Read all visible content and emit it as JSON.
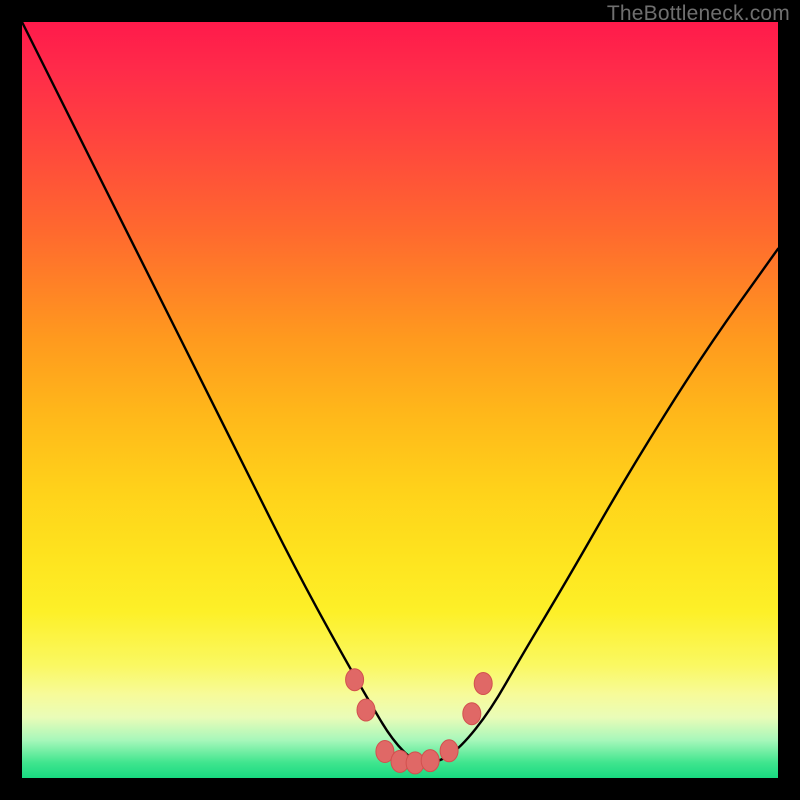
{
  "watermark": "TheBottleneck.com",
  "colors": {
    "page_bg": "#000000",
    "curve_stroke": "#000000",
    "marker_fill": "#e06866",
    "marker_stroke": "#d2504e",
    "watermark": "#6f6f6f"
  },
  "chart_data": {
    "type": "line",
    "title": "",
    "xlabel": "",
    "ylabel": "",
    "xlim": [
      0,
      100
    ],
    "ylim": [
      0,
      100
    ],
    "grid": false,
    "legend": false,
    "background": "vertical-gradient red→orange→yellow→green (top→bottom)",
    "series": [
      {
        "name": "bottleneck-curve",
        "x": [
          0,
          6,
          12,
          18,
          24,
          30,
          36,
          42,
          46,
          49,
          52,
          55,
          58,
          62,
          66,
          72,
          80,
          90,
          100
        ],
        "y": [
          100,
          88,
          76,
          64,
          52,
          40,
          28,
          17,
          10,
          5,
          2,
          2,
          4,
          9,
          16,
          26,
          40,
          56,
          70
        ]
      }
    ],
    "markers": [
      {
        "x": 44.0,
        "y": 13.0
      },
      {
        "x": 45.5,
        "y": 9.0
      },
      {
        "x": 48.0,
        "y": 3.5
      },
      {
        "x": 50.0,
        "y": 2.2
      },
      {
        "x": 52.0,
        "y": 2.0
      },
      {
        "x": 54.0,
        "y": 2.3
      },
      {
        "x": 56.5,
        "y": 3.6
      },
      {
        "x": 59.5,
        "y": 8.5
      },
      {
        "x": 61.0,
        "y": 12.5
      }
    ]
  }
}
